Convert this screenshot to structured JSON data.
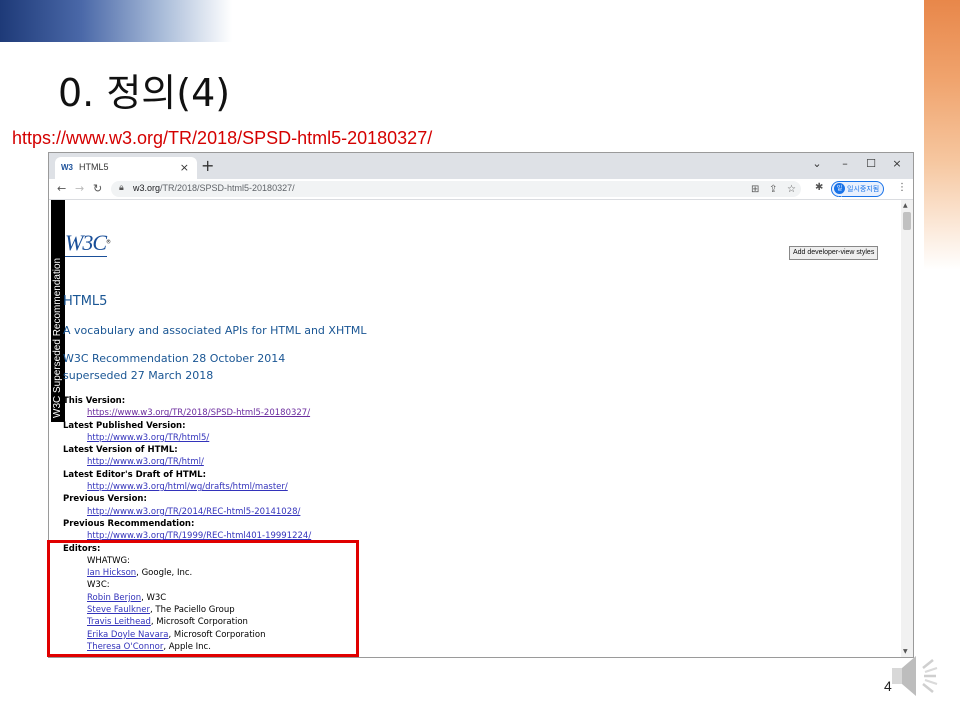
{
  "slide": {
    "title": "0. 정의(4)",
    "url_caption": "https://www.w3.org/TR/2018/SPSD-html5-20180327/",
    "page_number": "4"
  },
  "browser": {
    "tab": {
      "favicon": "W3",
      "title": "HTML5",
      "close": "×"
    },
    "new_tab": "+",
    "window_controls": {
      "minimize": "–",
      "maximize": "☐",
      "close": "×",
      "dropdown": "⌄"
    },
    "address": {
      "host": "w3.org",
      "path": "/TR/2018/SPSD-html5-20180327/"
    },
    "profile": {
      "avatar": "일시",
      "name": "일시중지됨"
    }
  },
  "page": {
    "side_banner": "W3C Superseded Recommendation",
    "logo": "W3C",
    "dev_button": "Add developer-view styles",
    "title": "HTML5",
    "subtitle": "A vocabulary and associated APIs for HTML and XHTML",
    "status": "W3C Recommendation 28 October 2014",
    "superseded": "superseded 27 March 2018",
    "meta": {
      "this_version_label": "This Version:",
      "this_version_url": "https://www.w3.org/TR/2018/SPSD-html5-20180327/",
      "latest_published_label": "Latest Published Version:",
      "latest_published_url": "http://www.w3.org/TR/html5/",
      "latest_html_label": "Latest Version of HTML:",
      "latest_html_url": "http://www.w3.org/TR/html/",
      "latest_editors_label": "Latest Editor's Draft of HTML:",
      "latest_editors_url": "http://www.w3.org/html/wg/drafts/html/master/",
      "previous_version_label": "Previous Version:",
      "previous_version_url": "http://www.w3.org/TR/2014/REC-html5-20141028/",
      "previous_rec_label": "Previous Recommendation:",
      "previous_rec_url": "http://www.w3.org/TR/1999/REC-html401-19991224/",
      "editors_label": "Editors:",
      "whatwg_label": "WHATWG:",
      "w3c_label": "W3C:"
    },
    "editors": [
      {
        "name": "Ian Hickson",
        "affiliation": ", Google, Inc."
      },
      {
        "name": "Robin Berjon",
        "affiliation": ", W3C"
      },
      {
        "name": "Steve Faulkner",
        "affiliation": ", The Paciello Group"
      },
      {
        "name": "Travis Leithead",
        "affiliation": ", Microsoft Corporation"
      },
      {
        "name": "Erika Doyle Navara",
        "affiliation": ", Microsoft Corporation"
      },
      {
        "name": "Theresa O'Connor",
        "affiliation": ", Apple Inc."
      }
    ]
  },
  "colors": {
    "caption": "#d40000",
    "highlight": "#e00000",
    "link": "#3333bb",
    "heading": "#1a5694"
  }
}
